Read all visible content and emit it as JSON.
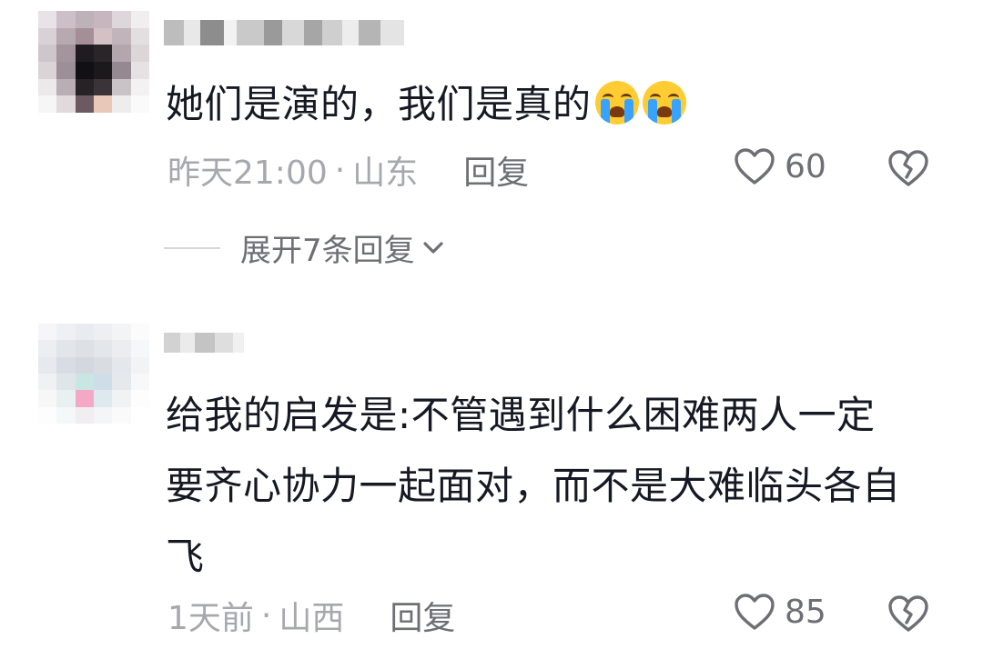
{
  "comments": [
    {
      "text": "她们是演的，我们是真的",
      "emoji": [
        "loudly-crying-face",
        "loudly-crying-face"
      ],
      "time": "昨天21:00",
      "separator": "·",
      "location": "山东",
      "reply_label": "回复",
      "likes": "60"
    },
    {
      "text_lines": [
        "给我的启发是:不管遇到什么困难两人一定",
        "要齐心协力一起面对，而不是大难临头各自",
        "飞"
      ],
      "time": "1天前",
      "separator": "·",
      "location": "山西",
      "reply_label": "回复",
      "likes": "85"
    }
  ],
  "expand_replies": {
    "label": "展开7条回复",
    "icon": "chevron-down-icon"
  },
  "colors": {
    "text": "#161823",
    "meta": "#a6a8ad",
    "action": "#6d6f75",
    "emoji_face": "#ffcc33"
  }
}
